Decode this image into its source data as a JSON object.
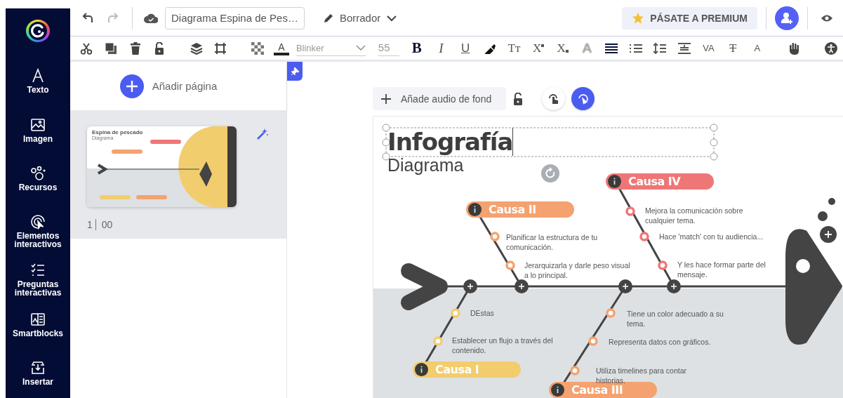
{
  "sidebar": {
    "items": [
      {
        "label": "Texto"
      },
      {
        "label": "Imagen"
      },
      {
        "label": "Recursos"
      },
      {
        "label": "Elementos interactivos"
      },
      {
        "label": "Preguntas interactivas"
      },
      {
        "label": "Smartblocks"
      },
      {
        "label": "Insertar"
      }
    ]
  },
  "top_bar": {
    "undo": {
      "disabled": false
    },
    "redo": {
      "disabled": true
    },
    "document_title": "Diagrama Espina de Pes…",
    "status": "Borrador",
    "premium_button": "PÁSATE A PREMIUM"
  },
  "toolbar": {
    "font": "Blinker",
    "font_size": "55",
    "glyphs": [
      "A",
      "B",
      "I",
      "U",
      "Tт",
      "X",
      "X",
      "A",
      "VA",
      "T",
      "A"
    ]
  },
  "pages_panel": {
    "add_page": "Añadir página",
    "pages": [
      {
        "number": "1",
        "duration": "00",
        "selected": true,
        "thumbnail": {
          "title": "Espina de pescado",
          "subtitle": "Diagrama"
        }
      }
    ]
  },
  "canvas": {
    "audio_placeholder": "Añade audio de fond",
    "title": "Infografía",
    "subtitle": "Diagrama",
    "title_selected": true,
    "causes": [
      {
        "label": "Causa II",
        "color": "#f4a26f",
        "items": [
          "Planificar la estructura de tu comunicación.",
          "Jerarquizarla y darle peso visual a lo principal."
        ]
      },
      {
        "label": "Causa IV",
        "color": "#ef7676",
        "items": [
          "Mejora la comunicación sobre cualquier tema.",
          "Hace 'match' con tu audiencia...",
          "Y les hace formar parte del mensaje."
        ]
      },
      {
        "label": "Causa I",
        "color": "#f2cd6e",
        "items": [
          "DEstas",
          "Establecer un flujo a través del contenido."
        ]
      },
      {
        "label": "Causa III",
        "color": "#f4a26f",
        "items": [
          "Tiene un color adecuado a su tema.",
          "Representa datos con gráficos.",
          "Utiliza timelines para contar historias."
        ]
      }
    ]
  }
}
